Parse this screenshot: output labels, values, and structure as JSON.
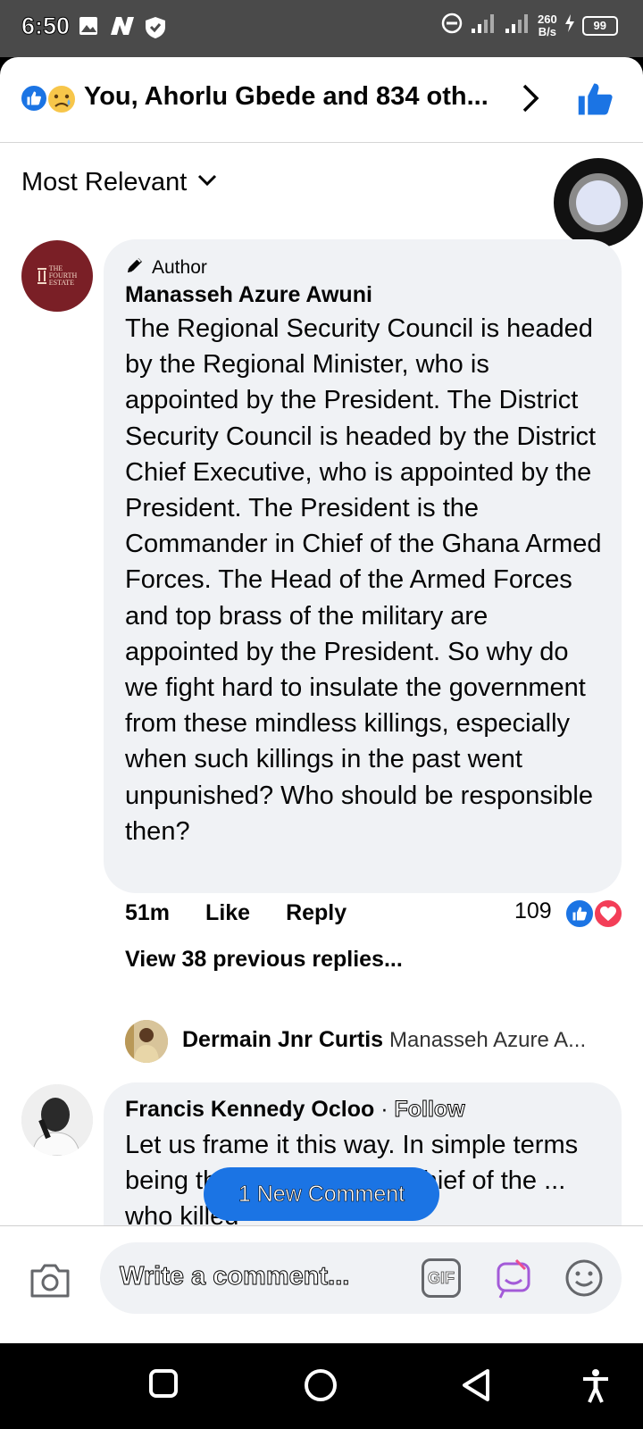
{
  "status_bar": {
    "time": "6:50",
    "net_speed_top": "260",
    "net_speed_bottom": "B/s",
    "battery": "99"
  },
  "reactions_header": {
    "summary": "You, Ahorlu Gbede and 834 oth...",
    "like_color": "#1b74e4"
  },
  "sort": {
    "label": "Most Relevant"
  },
  "comment1": {
    "badge": "Author",
    "name": "Manasseh Azure Awuni",
    "text": "The Regional Security Council is headed by the Regional Minister, who is appointed by the President. The District Security Council is headed by the District Chief Executive, who is appointed by the President. The President is the Commander in Chief of the Ghana Armed Forces. The Head of the Armed Forces and top brass of the military are appointed by the President. So why do we fight hard to insulate the government from these mindless killings, especially when such killings in the past went unpunished? Who should be responsible then?",
    "avatar_logo_lines": [
      "THE",
      "FOURTH",
      "ESTATE"
    ],
    "time": "51m",
    "like_label": "Like",
    "reply_label": "Reply",
    "reaction_count": "109"
  },
  "replies": {
    "view_previous": "View 38 previous replies...",
    "latest_name": "Dermain Jnr Curtis",
    "latest_text": "Manasseh Azure A..."
  },
  "comment2": {
    "name": "Francis Kennedy Ocloo",
    "separator": " · ",
    "follow_label": "Follow",
    "text": "Let us frame it this way. In simple terms being the commander in chief of the ... who killed"
  },
  "new_comment": {
    "label": "1 New Comment"
  },
  "composer": {
    "placeholder": "Write a comment...",
    "gif_label": "GIF"
  }
}
